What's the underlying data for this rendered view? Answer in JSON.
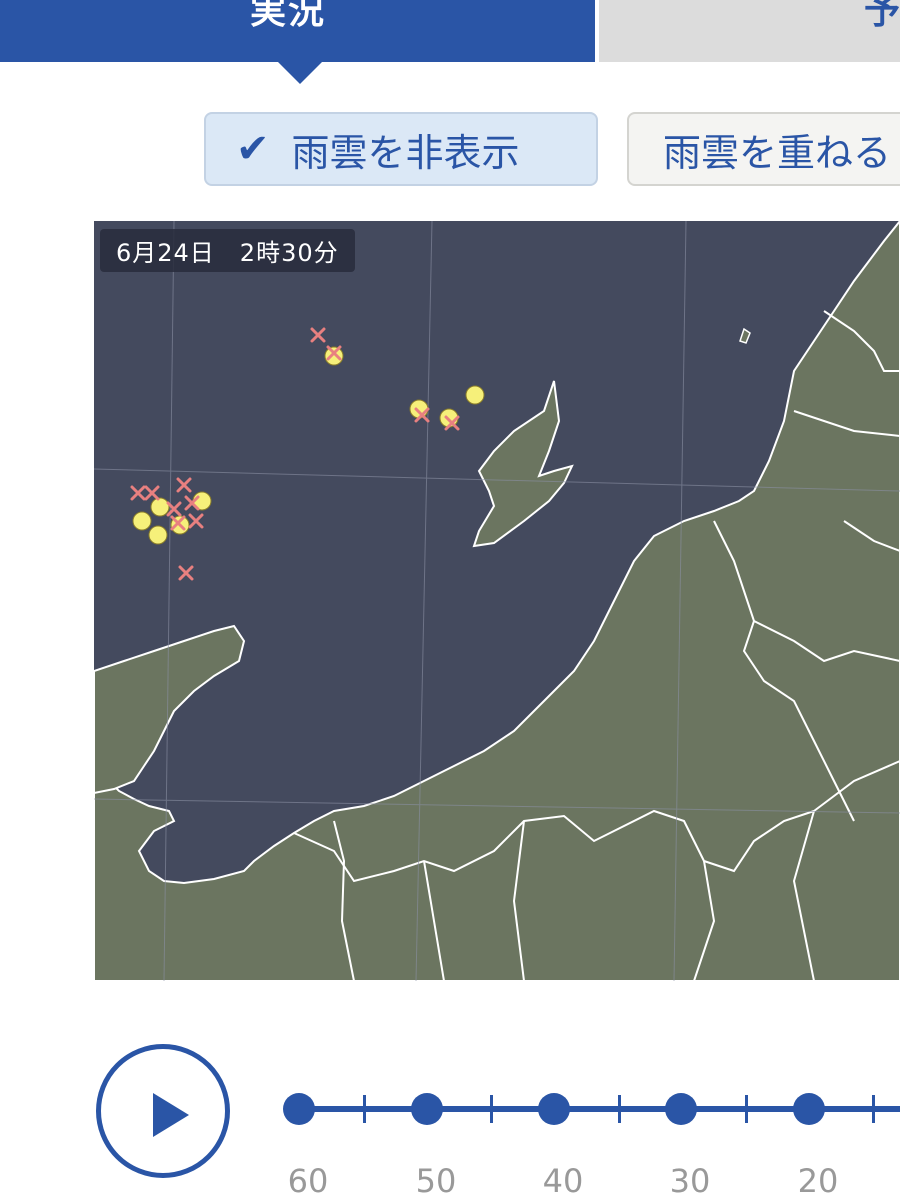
{
  "tabs": {
    "active_label": "実況",
    "inactive_label": "予"
  },
  "rain_toggle": {
    "check_icon": "check-icon",
    "hide_label": "雨雲を非表示",
    "overlay_label": "雨雲を重ねる"
  },
  "map": {
    "timestamp": "6月24日　2時30分",
    "colors": {
      "sea": "#444a5e",
      "land": "#6b7560",
      "border": "#ffffff",
      "lightning_cloud": "#f6f07a",
      "lightning_strike": "#e88080"
    },
    "legend_icons": [
      "yellow-circle-lightning-icon",
      "red-x-lightning-icon"
    ]
  },
  "timeline": {
    "play_icon": "play-icon",
    "labels": [
      "60",
      "50",
      "40",
      "30",
      "20"
    ]
  }
}
